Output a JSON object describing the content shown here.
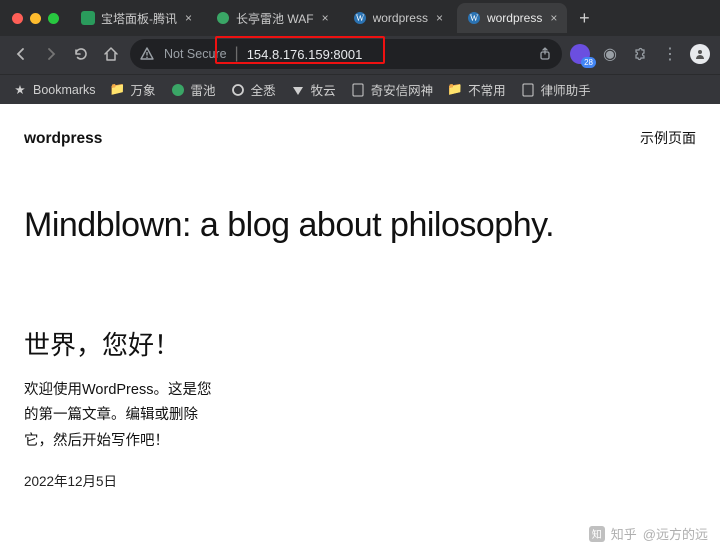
{
  "browser": {
    "tabs": [
      {
        "label": "宝塔面板-腾讯",
        "active": false,
        "favicon": "bt"
      },
      {
        "label": "长亭雷池 WAF",
        "active": false,
        "favicon": "ct"
      },
      {
        "label": "wordpress",
        "active": false,
        "favicon": "wp"
      },
      {
        "label": "wordpress",
        "active": true,
        "favicon": "wp"
      }
    ],
    "add_tab_label": "+",
    "toolbar": {
      "not_secure_label": "Not Secure",
      "url": "154.8.176.159:8001",
      "ext_badge": "28"
    },
    "bookmarks": [
      {
        "icon": "star",
        "label": "Bookmarks"
      },
      {
        "icon": "folder",
        "label": "万象"
      },
      {
        "icon": "ct",
        "label": "雷池"
      },
      {
        "icon": "ring",
        "label": "全悉"
      },
      {
        "icon": "my",
        "label": "牧云"
      },
      {
        "icon": "blank",
        "label": "奇安信网神"
      },
      {
        "icon": "folder",
        "label": "不常用"
      },
      {
        "icon": "blank",
        "label": "律师助手"
      }
    ]
  },
  "page": {
    "site_title": "wordpress",
    "nav_link": "示例页面",
    "hero": "Mindblown: a blog about philosophy.",
    "post_title": "世界，您好！",
    "post_body": "欢迎使用WordPress。这是您的第一篇文章。编辑或删除它，然后开始写作吧！",
    "post_date": "2022年12月5日"
  },
  "watermark": {
    "brand": "知乎",
    "user": "@远方的远"
  }
}
